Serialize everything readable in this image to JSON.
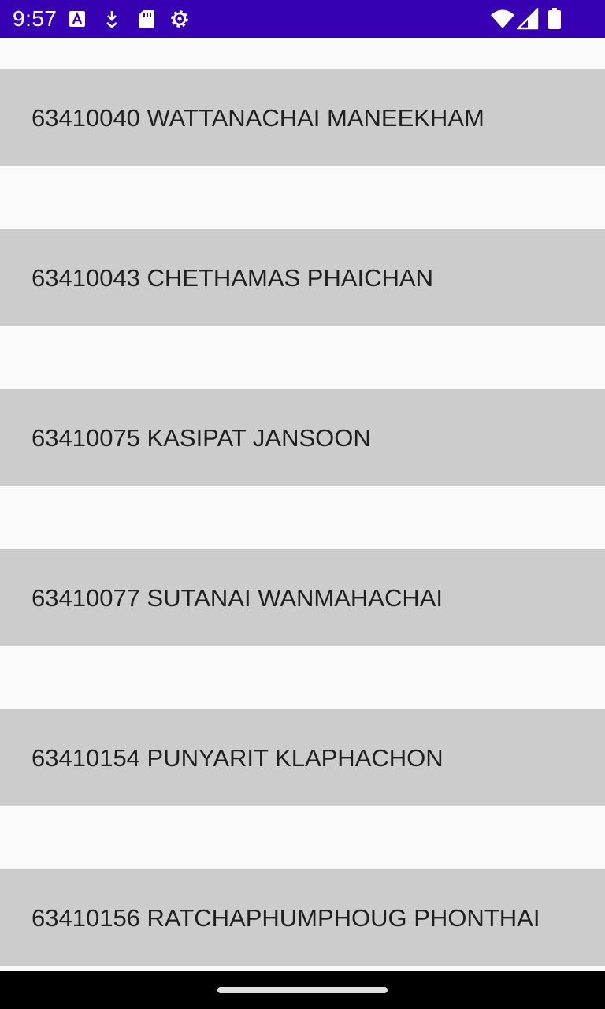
{
  "status_bar": {
    "time": "9:57",
    "background_color": "#3700b3",
    "left_icons": [
      "font-a-icon",
      "download-icon",
      "sd-card-icon",
      "settings-gear-icon"
    ],
    "right_icons": [
      "wifi-icon",
      "cellular-signal-icon",
      "battery-icon"
    ]
  },
  "list": {
    "item_background": "#cccccc",
    "page_background": "#fafafa",
    "items": [
      {
        "label": "63410040 WATTANACHAI MANEEKHAM"
      },
      {
        "label": "63410043 CHETHAMAS PHAICHAN"
      },
      {
        "label": "63410075 KASIPAT JANSOON"
      },
      {
        "label": "63410077 SUTANAI WANMAHACHAI"
      },
      {
        "label": "63410154 PUNYARIT KLAPHACHON"
      },
      {
        "label": "63410156 RATCHAPHUMPHOUG PHONTHAI"
      }
    ]
  },
  "nav_bar": {
    "handle_icon": "home-gesture-handle"
  }
}
